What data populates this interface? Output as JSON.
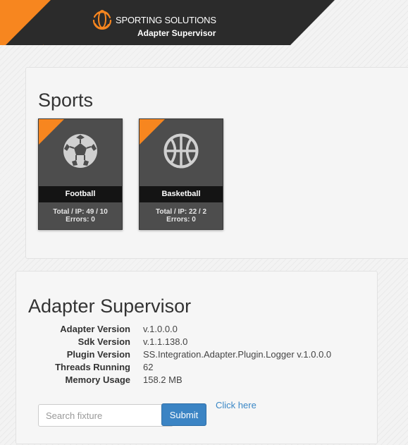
{
  "header": {
    "brand_name": "SPORTING SOLUTIONS",
    "subtitle": "Adapter Supervisor",
    "colors": {
      "dark": "#2b2b2b",
      "accent": "#f7861f"
    }
  },
  "sports": {
    "title": "Sports",
    "tiles": [
      {
        "name": "Football",
        "icon": "soccer-ball-icon",
        "stats": "Total / IP: 49 / 10",
        "errors": "Errors: 0"
      },
      {
        "name": "Basketball",
        "icon": "basketball-icon",
        "stats": "Total / IP: 22 / 2",
        "errors": "Errors: 0"
      }
    ]
  },
  "adapter": {
    "title": "Adapter Supervisor",
    "rows": [
      {
        "label": "Adapter Version",
        "value": "v.1.0.0.0"
      },
      {
        "label": "Sdk Version",
        "value": "v.1.1.138.0"
      },
      {
        "label": "Plugin Version",
        "value": "SS.Integration.Adapter.Plugin.Logger v.1.0.0.0"
      },
      {
        "label": "Threads Running",
        "value": "62"
      },
      {
        "label": "Memory Usage",
        "value": "158.2 MB"
      }
    ],
    "search": {
      "placeholder": "Search fixture",
      "value": ""
    },
    "submit_label": "Submit",
    "link_label": "Click here"
  }
}
